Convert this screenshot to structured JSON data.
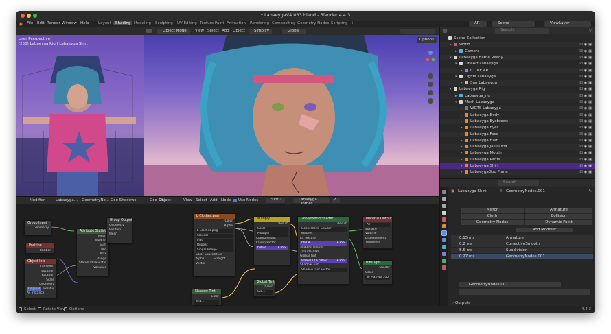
{
  "window": {
    "title": "* LabaeygaV4.033.blend - Blender 4.4.3"
  },
  "menu": [
    "File",
    "Edit",
    "Render",
    "Window",
    "Help"
  ],
  "workspaces": {
    "active_index": 1,
    "tabs": [
      "Layout",
      "Shading",
      "Modeling",
      "Sculpting",
      "UV Editing",
      "Texture Paint",
      "Animation",
      "Rendering",
      "Compositing",
      "Geometry Nodes",
      "Scripting"
    ],
    "add": "+"
  },
  "topbar_right": {
    "ar": "AR",
    "scene": "Scene",
    "view_layer": "ViewLayer"
  },
  "viewport": {
    "mode": "Object Mode",
    "menus": [
      "View",
      "Select",
      "Add",
      "Object"
    ],
    "simplify": "Simplify",
    "orientation": "Global",
    "options": "Options",
    "camera_label": "User Perspective",
    "camera_sublabel": "(250) Labaeyga Rig | Labaeyga Shirt"
  },
  "outliner": {
    "search_placeholder": "Search",
    "rows": [
      {
        "label": "Scene Collection",
        "indent": 0,
        "arrow": "",
        "icon": "#d8d8d8"
      },
      {
        "label": "World",
        "indent": 1,
        "arrow": "▸",
        "icon": "#d05a5a"
      },
      {
        "label": "Camera",
        "indent": 2,
        "arrow": "▸",
        "icon": "#59b0d9"
      },
      {
        "label": "Labaeyga Battle Ready",
        "indent": 1,
        "arrow": "▾",
        "icon": "#d8d8d8"
      },
      {
        "label": "LineArt Labaeyga",
        "indent": 2,
        "arrow": "▾",
        "icon": "#d8d8d8"
      },
      {
        "label": "L LINE ART",
        "indent": 3,
        "arrow": "▸",
        "icon": "#9b7be0"
      },
      {
        "label": "Lights Labaeyga",
        "indent": 2,
        "arrow": "▾",
        "icon": "#d8d8d8"
      },
      {
        "label": "Sun Labaeyga",
        "indent": 3,
        "arrow": "▸",
        "icon": "#e6c35a"
      },
      {
        "label": "Labaeyga Rig",
        "indent": 1,
        "arrow": "▾",
        "icon": "#d8d8d8"
      },
      {
        "label": "Labaeyga_rig",
        "indent": 2,
        "arrow": "▸",
        "icon": "#59b0d9"
      },
      {
        "label": "Mesh Labaeyga",
        "indent": 2,
        "arrow": "▾",
        "icon": "#d8d8d8"
      },
      {
        "label": "WGTS Labaeyga",
        "indent": 3,
        "arrow": "▸",
        "icon": "#7a7a7a"
      },
      {
        "label": "Labaeyga Body",
        "indent": 3,
        "arrow": "▸",
        "icon": "#e08a3a"
      },
      {
        "label": "Labaeyga Eyebrows",
        "indent": 3,
        "arrow": "▸",
        "icon": "#e08a3a"
      },
      {
        "label": "Labaeyga Eyes",
        "indent": 3,
        "arrow": "▸",
        "icon": "#e08a3a"
      },
      {
        "label": "Labaeyga Face",
        "indent": 3,
        "arrow": "▸",
        "icon": "#e08a3a"
      },
      {
        "label": "Labaeyga Hair",
        "indent": 3,
        "arrow": "▸",
        "icon": "#e08a3a"
      },
      {
        "label": "Labaeyga Jail Outfit",
        "indent": 3,
        "arrow": "▸",
        "icon": "#e08a3a"
      },
      {
        "label": "Labaeyga Mouth",
        "indent": 3,
        "arrow": "▸",
        "icon": "#e08a3a"
      },
      {
        "label": "Labaeyga Pants",
        "indent": 3,
        "arrow": "▸",
        "icon": "#e08a3a"
      },
      {
        "label": "Labaeyga Shirt",
        "indent": 3,
        "arrow": "▸",
        "icon": "#e08a3a"
      },
      {
        "label": "LabaeygaGoo Plane",
        "indent": 3,
        "arrow": "▸",
        "icon": "#e08a3a"
      }
    ],
    "selected_index": 20
  },
  "properties": {
    "search_placeholder": "Search",
    "object_name": "Labaeyga Shirt",
    "modifier_name": "GeometryNodes.001",
    "buttons": [
      "Mirror",
      "Armature",
      "Cloth",
      "Collision",
      "Geometry Nodes",
      "Dynamic Paint"
    ],
    "add_modifier": "Add Modifier",
    "modifier_stack": [
      {
        "time": "0.15 ms",
        "name": "Armature"
      },
      {
        "time": "0.2 ms",
        "name": "CorrectiveSmooth"
      },
      {
        "time": "5.5 ms",
        "name": "Subdivision"
      },
      {
        "time": "0.27 ms",
        "name": "GeometryNodes.001"
      }
    ],
    "nodegroup_name": "GeometryNodes.001",
    "sections": [
      "Outputs",
      "Manage"
    ]
  },
  "nodes_header": {
    "modifier": "Modifier",
    "obj1": "Labaeyga...",
    "tree": "GeometryNo...",
    "goo": "Goo Shadows",
    "goo2": "Goo Sh...",
    "object": "Object",
    "menus": [
      "View",
      "Select",
      "Add",
      "Node"
    ],
    "use_nodes": "Use Nodes",
    "slot": "Slot 1",
    "material": "Labaeyga Clothes",
    "user_count": "2"
  },
  "nodes": {
    "group_input": "Group Input",
    "group_input_geo": "Geometry",
    "attribute": "Attribute Statistic",
    "attribute_rows": [
      "Mean",
      "Median",
      "Sum",
      "Min",
      "Max",
      "Range",
      "Standard Deviation",
      "Variance"
    ],
    "group_output": "Group Output",
    "group_output_rows": [
      "Geometry",
      "Position",
      "Mean"
    ],
    "position": "Position",
    "object_info": "Object Info",
    "object_info_rows": [
      "Transform",
      "Location",
      "Rotation",
      "Scale",
      "Geometry"
    ],
    "original": "Original",
    "relative": "Relative",
    "as_instance": "As Instance",
    "image_tex": "L Clothes.png",
    "image_tex_out": [
      "Color",
      "Alpha"
    ],
    "image_tex_fields": [
      "Closest",
      "Flat",
      "Repeat",
      "Single Image",
      "sRGB",
      "Straight"
    ],
    "color_space_label": "Color Space",
    "alpha_label": "Alpha",
    "vector_label": "Vector",
    "multiply": "Multiply",
    "multiply_rows": [
      "Result",
      "Color",
      "Multiply",
      "Clamp Result",
      "Clamp Factor"
    ],
    "factor_label": "Factor",
    "factor_value": "1.000",
    "shader": "GooseWorld Shader",
    "shader_rows": [
      "Result",
      "GooseWorld Shader",
      "Textures",
      "Lit Texture",
      "Shaded Texture",
      "Tint Settings",
      "Global Tint",
      "Global Tint Factor",
      "Shadow Tint",
      "Shadow Tint Factor"
    ],
    "alpha_row": "Alpha",
    "alpha_value": "1.000",
    "tint_factor_value": "1.000",
    "material_output": "Material Output",
    "material_output_rows": [
      "All",
      "Surface",
      "Volume",
      "Displacement",
      "Thickness"
    ],
    "rim_light": "RimLight",
    "rim_rows": [
      "Shader",
      "Color",
      "To Max"
    ],
    "rim_value": "-46.700",
    "shadow_tint": "Shadow Tint",
    "global_tint": "Global Tint",
    "color_label": "Color",
    "node_small": "Sha...",
    "node_small2": "Glo..."
  },
  "status": {
    "select": "Select",
    "rotate": "Rotate View",
    "options": "Options",
    "version": "4.4.3"
  }
}
